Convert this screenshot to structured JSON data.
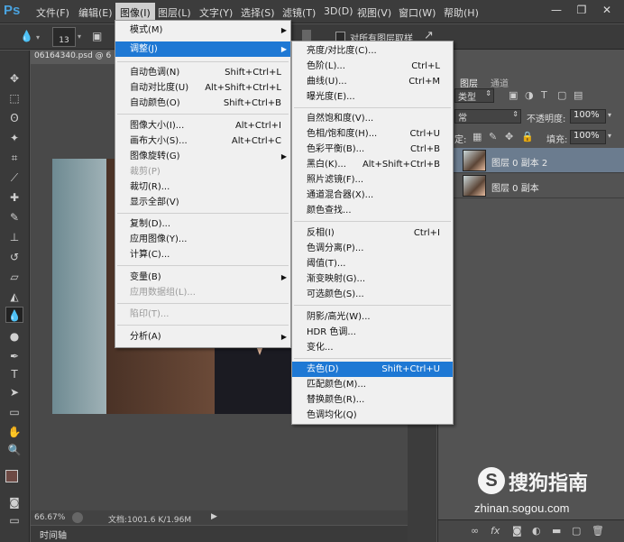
{
  "app": {
    "logo": "Ps"
  },
  "menubar": {
    "items": [
      "文件(F)",
      "编辑(E)",
      "图像(I)",
      "图层(L)",
      "文字(Y)",
      "选择(S)",
      "滤镜(T)",
      "3D(D)",
      "视图(V)",
      "窗口(W)",
      "帮助(H)"
    ],
    "window_controls": [
      "minimize-icon",
      "restore-icon",
      "close-icon"
    ]
  },
  "options_bar": {
    "brush_size": "13",
    "sample_all_layers": "对所有图层取样"
  },
  "document": {
    "tab_title": "06164340.psd @ 6",
    "zoom": "66.67%",
    "doc_info": "文档:1001.6 K/1.96M"
  },
  "timeline": {
    "label": "时间轴"
  },
  "image_menu": {
    "items": [
      {
        "label": "模式(M)",
        "shortcut": "",
        "submenu": true,
        "disabled": false
      },
      {
        "label": "调整(J)",
        "shortcut": "",
        "submenu": true,
        "disabled": false,
        "highlighted": true
      },
      {
        "label": "自动色调(N)",
        "shortcut": "Shift+Ctrl+L"
      },
      {
        "label": "自动对比度(U)",
        "shortcut": "Alt+Shift+Ctrl+L"
      },
      {
        "label": "自动颜色(O)",
        "shortcut": "Shift+Ctrl+B"
      },
      {
        "label": "图像大小(I)...",
        "shortcut": "Alt+Ctrl+I"
      },
      {
        "label": "画布大小(S)...",
        "shortcut": "Alt+Ctrl+C"
      },
      {
        "label": "图像旋转(G)",
        "shortcut": "",
        "submenu": true
      },
      {
        "label": "裁剪(P)",
        "shortcut": "",
        "disabled": true
      },
      {
        "label": "裁切(R)...",
        "shortcut": ""
      },
      {
        "label": "显示全部(V)",
        "shortcut": ""
      },
      {
        "label": "复制(D)...",
        "shortcut": ""
      },
      {
        "label": "应用图像(Y)...",
        "shortcut": ""
      },
      {
        "label": "计算(C)...",
        "shortcut": ""
      },
      {
        "label": "变量(B)",
        "shortcut": "",
        "submenu": true
      },
      {
        "label": "应用数据组(L)...",
        "shortcut": "",
        "disabled": true
      },
      {
        "label": "陷印(T)...",
        "shortcut": "",
        "disabled": true
      },
      {
        "label": "分析(A)",
        "shortcut": "",
        "submenu": true
      }
    ]
  },
  "adjust_menu": {
    "items": [
      {
        "label": "亮度/对比度(C)...",
        "shortcut": ""
      },
      {
        "label": "色阶(L)...",
        "shortcut": "Ctrl+L"
      },
      {
        "label": "曲线(U)...",
        "shortcut": "Ctrl+M"
      },
      {
        "label": "曝光度(E)...",
        "shortcut": ""
      },
      {
        "label": "自然饱和度(V)...",
        "shortcut": ""
      },
      {
        "label": "色相/饱和度(H)...",
        "shortcut": "Ctrl+U"
      },
      {
        "label": "色彩平衡(B)...",
        "shortcut": "Ctrl+B"
      },
      {
        "label": "黑白(K)...",
        "shortcut": "Alt+Shift+Ctrl+B"
      },
      {
        "label": "照片滤镜(F)...",
        "shortcut": ""
      },
      {
        "label": "通道混合器(X)...",
        "shortcut": ""
      },
      {
        "label": "颜色查找...",
        "shortcut": ""
      },
      {
        "label": "反相(I)",
        "shortcut": "Ctrl+I"
      },
      {
        "label": "色调分离(P)...",
        "shortcut": ""
      },
      {
        "label": "阈值(T)...",
        "shortcut": ""
      },
      {
        "label": "渐变映射(G)...",
        "shortcut": ""
      },
      {
        "label": "可选颜色(S)...",
        "shortcut": ""
      },
      {
        "label": "阴影/高光(W)...",
        "shortcut": ""
      },
      {
        "label": "HDR 色调...",
        "shortcut": ""
      },
      {
        "label": "变化...",
        "shortcut": ""
      },
      {
        "label": "去色(D)",
        "shortcut": "Shift+Ctrl+U",
        "highlighted": true
      },
      {
        "label": "匹配颜色(M)...",
        "shortcut": ""
      },
      {
        "label": "替换颜色(R)...",
        "shortcut": ""
      },
      {
        "label": "色调均化(Q)",
        "shortcut": ""
      }
    ]
  },
  "layers_panel": {
    "tabs": [
      "图层",
      "通道"
    ],
    "filter_kind": "类型",
    "blend_mode": "常",
    "opacity_label": "不透明度:",
    "opacity_value": "100%",
    "fill_label": "填充:",
    "fill_value": "100%",
    "lock_label": "定:",
    "layers": [
      {
        "name": "图层 0 副本 2",
        "selected": true
      },
      {
        "name": "图层 0 副本",
        "selected": false
      }
    ]
  },
  "watermark": {
    "brand": "搜狗指南",
    "url": "zhinan.sogou.com"
  },
  "colors": {
    "highlight": "#1e78d4",
    "menu_bg": "#f0f0f0",
    "selected_layer": "#6b7c8f"
  }
}
